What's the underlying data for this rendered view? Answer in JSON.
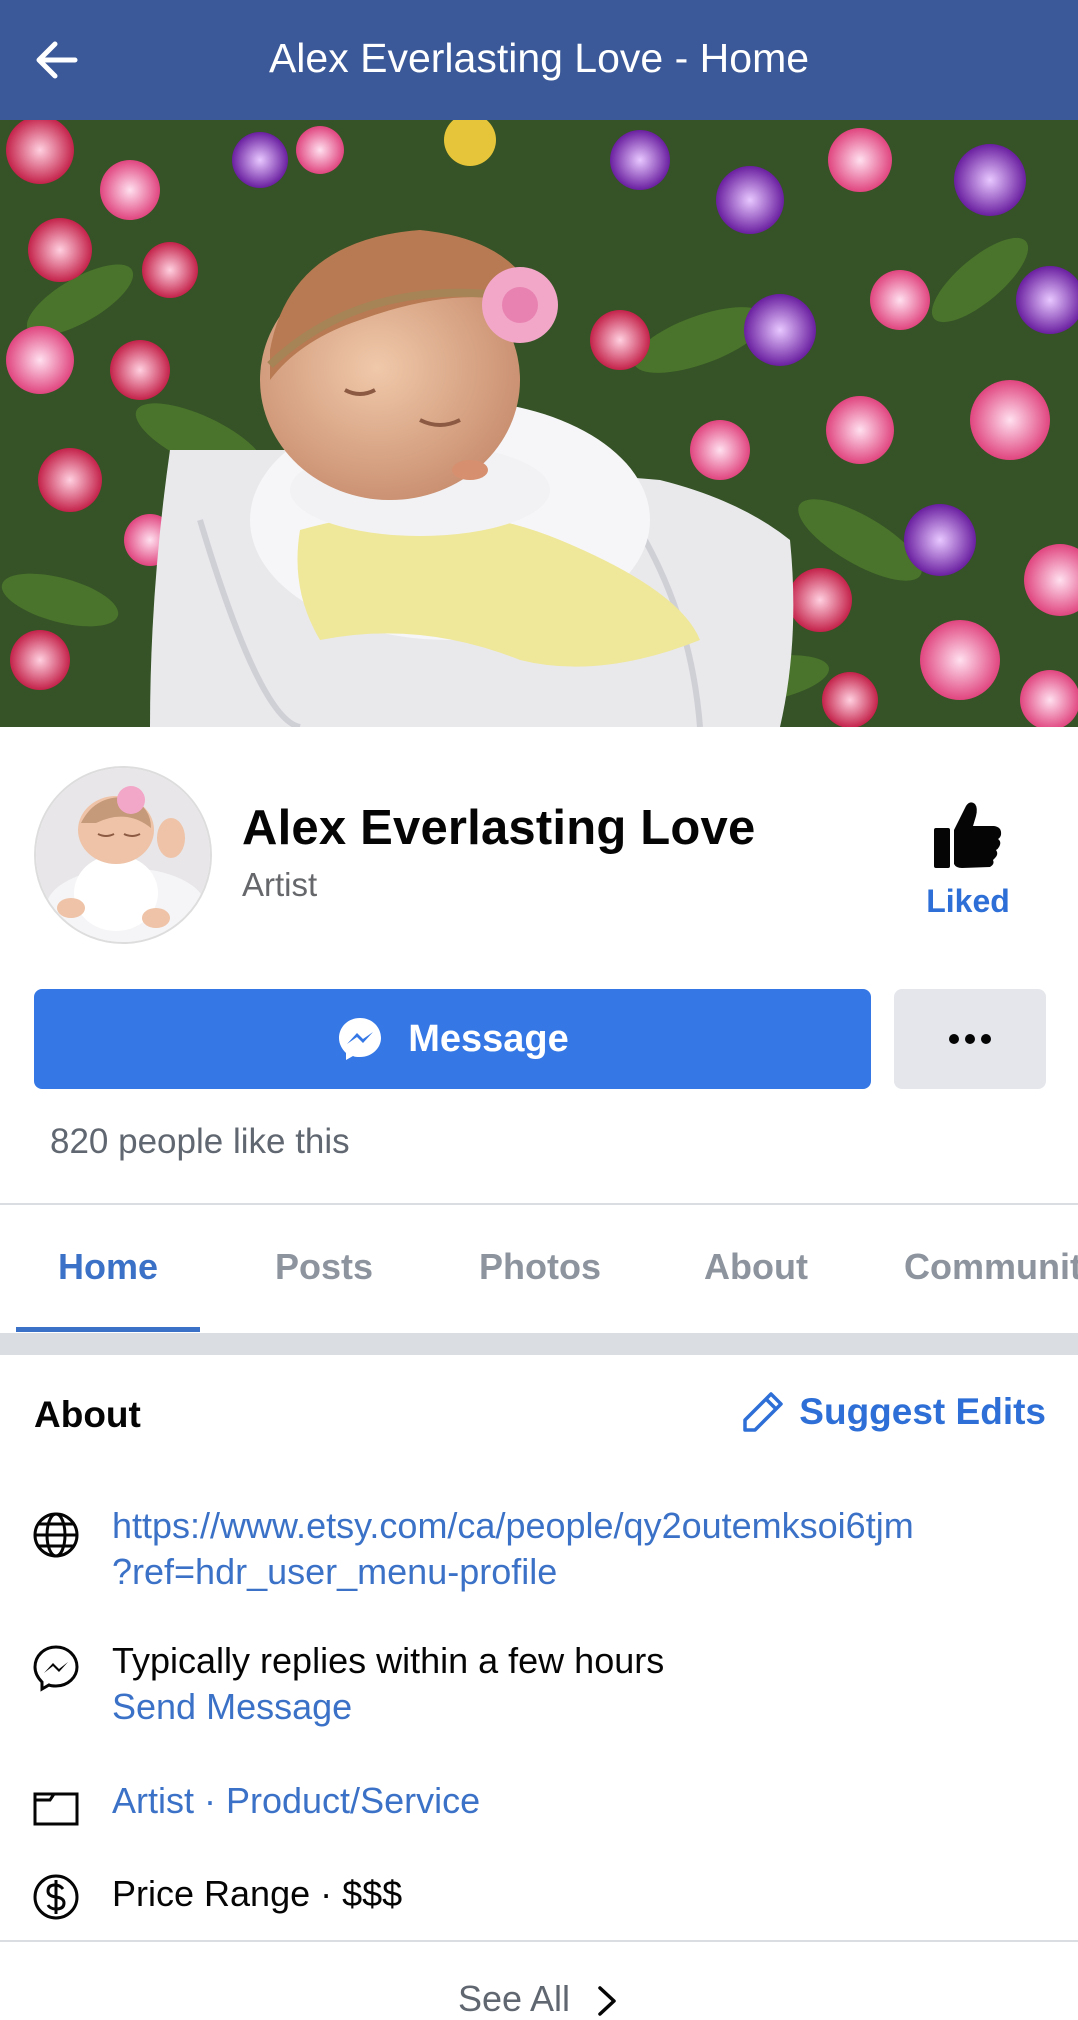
{
  "topbar": {
    "title": "Alex Everlasting Love - Home",
    "back_icon": "arrow-left-icon"
  },
  "profile": {
    "name": "Alex Everlasting Love",
    "category": "Artist",
    "like_status": "Liked"
  },
  "actions": {
    "message_label": "Message",
    "more_icon": "ellipsis-icon"
  },
  "likes_text": "820 people like this",
  "tabs": [
    {
      "label": "Home",
      "active": true
    },
    {
      "label": "Posts"
    },
    {
      "label": "Photos"
    },
    {
      "label": "About"
    },
    {
      "label": "Communit"
    }
  ],
  "about": {
    "heading": "About",
    "suggest_label": "Suggest Edits",
    "website_line1": "https://www.etsy.com/ca/people/qy2outemksoi6tjm",
    "website_line2": "?ref=hdr_user_menu-profile",
    "response_time": "Typically replies within a few hours",
    "send_message": "Send Message",
    "categories": "Artist · Product/Service",
    "price_range": "Price Range · $$$",
    "see_all": "See All"
  },
  "colors": {
    "header_bg": "#3b5998",
    "primary_button": "#3578e5",
    "link": "#3b72c7"
  }
}
